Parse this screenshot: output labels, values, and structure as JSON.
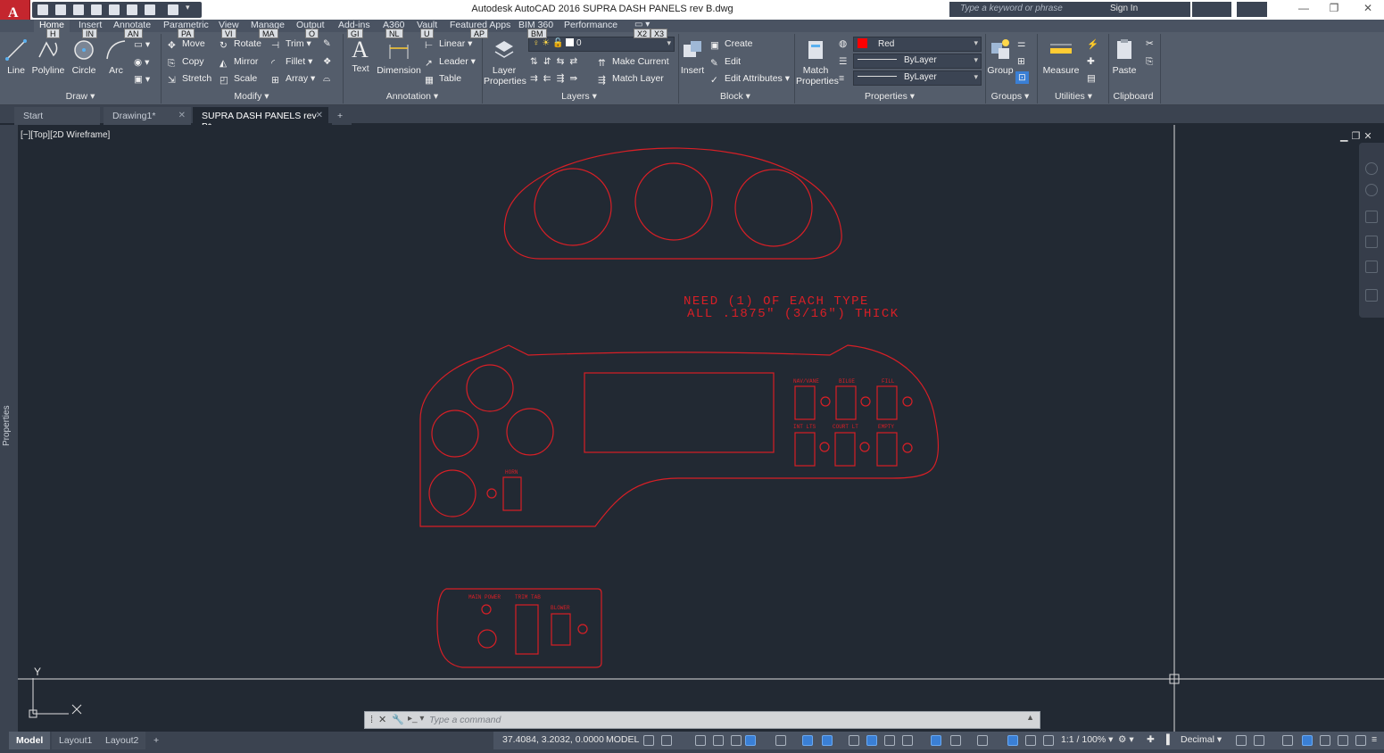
{
  "window": {
    "title": "Autodesk AutoCAD 2016    SUPRA DASH PANELS rev B.dwg",
    "app_letter": "A",
    "search_placeholder": "Type a keyword or phrase",
    "sign_in": "Sign In"
  },
  "ribbon_tabs": [
    {
      "label": "Home",
      "key": "H"
    },
    {
      "label": "Insert",
      "key": "IN"
    },
    {
      "label": "Annotate",
      "key": "AN"
    },
    {
      "label": "Parametric",
      "key": "PA"
    },
    {
      "label": "View",
      "key": "VI"
    },
    {
      "label": "Manage",
      "key": "MA"
    },
    {
      "label": "Output",
      "key": "O"
    },
    {
      "label": "Add-ins",
      "key": "GI"
    },
    {
      "label": "A360",
      "key": "NL"
    },
    {
      "label": "Vault",
      "key": "U"
    },
    {
      "label": "Featured Apps",
      "key": "AP"
    },
    {
      "label": "BIM 360",
      "key": "BM"
    },
    {
      "label": "Performance",
      "key": ""
    }
  ],
  "extra_keytips": [
    "X2",
    "X3"
  ],
  "ribbon": {
    "draw": {
      "title": "Draw",
      "line": "Line",
      "polyline": "Polyline",
      "circle": "Circle",
      "arc": "Arc"
    },
    "modify": {
      "title": "Modify",
      "move": "Move",
      "rotate": "Rotate",
      "trim": "Trim",
      "copy": "Copy",
      "mirror": "Mirror",
      "fillet": "Fillet",
      "stretch": "Stretch",
      "scale": "Scale",
      "array": "Array"
    },
    "annotation": {
      "title": "Annotation",
      "text": "Text",
      "dimension": "Dimension",
      "linear": "Linear",
      "leader": "Leader",
      "table": "Table"
    },
    "layers": {
      "title": "Layers",
      "layer_properties": "Layer Properties",
      "current_layer": "0",
      "make_current": "Make Current",
      "match_layer": "Match Layer"
    },
    "block": {
      "title": "Block",
      "insert": "Insert",
      "create": "Create",
      "edit": "Edit",
      "edit_attributes": "Edit Attributes"
    },
    "properties": {
      "title": "Properties",
      "match_properties": "Match Properties",
      "color": "Red",
      "color_hex": "#ff0000",
      "linetype": "ByLayer",
      "lineweight": "ByLayer"
    },
    "groups": {
      "title": "Groups",
      "group": "Group"
    },
    "utilities": {
      "title": "Utilities",
      "measure": "Measure"
    },
    "clipboard": {
      "title": "Clipboard",
      "paste": "Paste"
    }
  },
  "file_tabs": [
    {
      "label": "Start"
    },
    {
      "label": "Drawing1*"
    },
    {
      "label": "SUPRA DASH PANELS rev B*",
      "active": true
    }
  ],
  "viewport": {
    "label": "[−][Top][2D Wireframe]",
    "ucs_x": "X",
    "ucs_y": "Y"
  },
  "drawing_text": {
    "note_line1": "NEED (1) OF EACH TYPE",
    "note_line2": "ALL .1875\" (3/16\") THICK",
    "navvane": "NAV/VANE",
    "bilge": "BILGE",
    "fill": "FILL",
    "int_lts": "INT LTS",
    "court_lt": "COURT LT",
    "empty": "EMPTY",
    "horn": "HORN",
    "main_power": "MAIN POWER",
    "trim_tab": "TRIM TAB",
    "blower": "BLOWER",
    "stroke_color": "#d81f26"
  },
  "side_palette": "Properties",
  "command_line": {
    "placeholder": "Type a command"
  },
  "layout_tabs": [
    {
      "label": "Model",
      "active": true
    },
    {
      "label": "Layout1"
    },
    {
      "label": "Layout2"
    }
  ],
  "status": {
    "coords": "37.4084, 3.2032, 0.0000",
    "space": "MODEL",
    "scale": "1:1 / 100%",
    "units": "Decimal"
  }
}
